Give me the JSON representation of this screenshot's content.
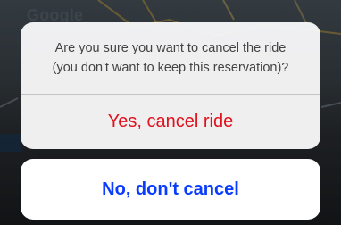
{
  "map": {
    "logo": "Google"
  },
  "dialog": {
    "message_line1": "Are you sure you want to cancel the ride",
    "message_line2": "(you don't want to keep this reservation)?",
    "confirm_label": "Yes, cancel ride",
    "dismiss_label": "No, don't cancel"
  },
  "colors": {
    "destructive": "#e8101c",
    "dismiss": "#0a3cff",
    "sheet_bg": "#f6f6f7"
  }
}
